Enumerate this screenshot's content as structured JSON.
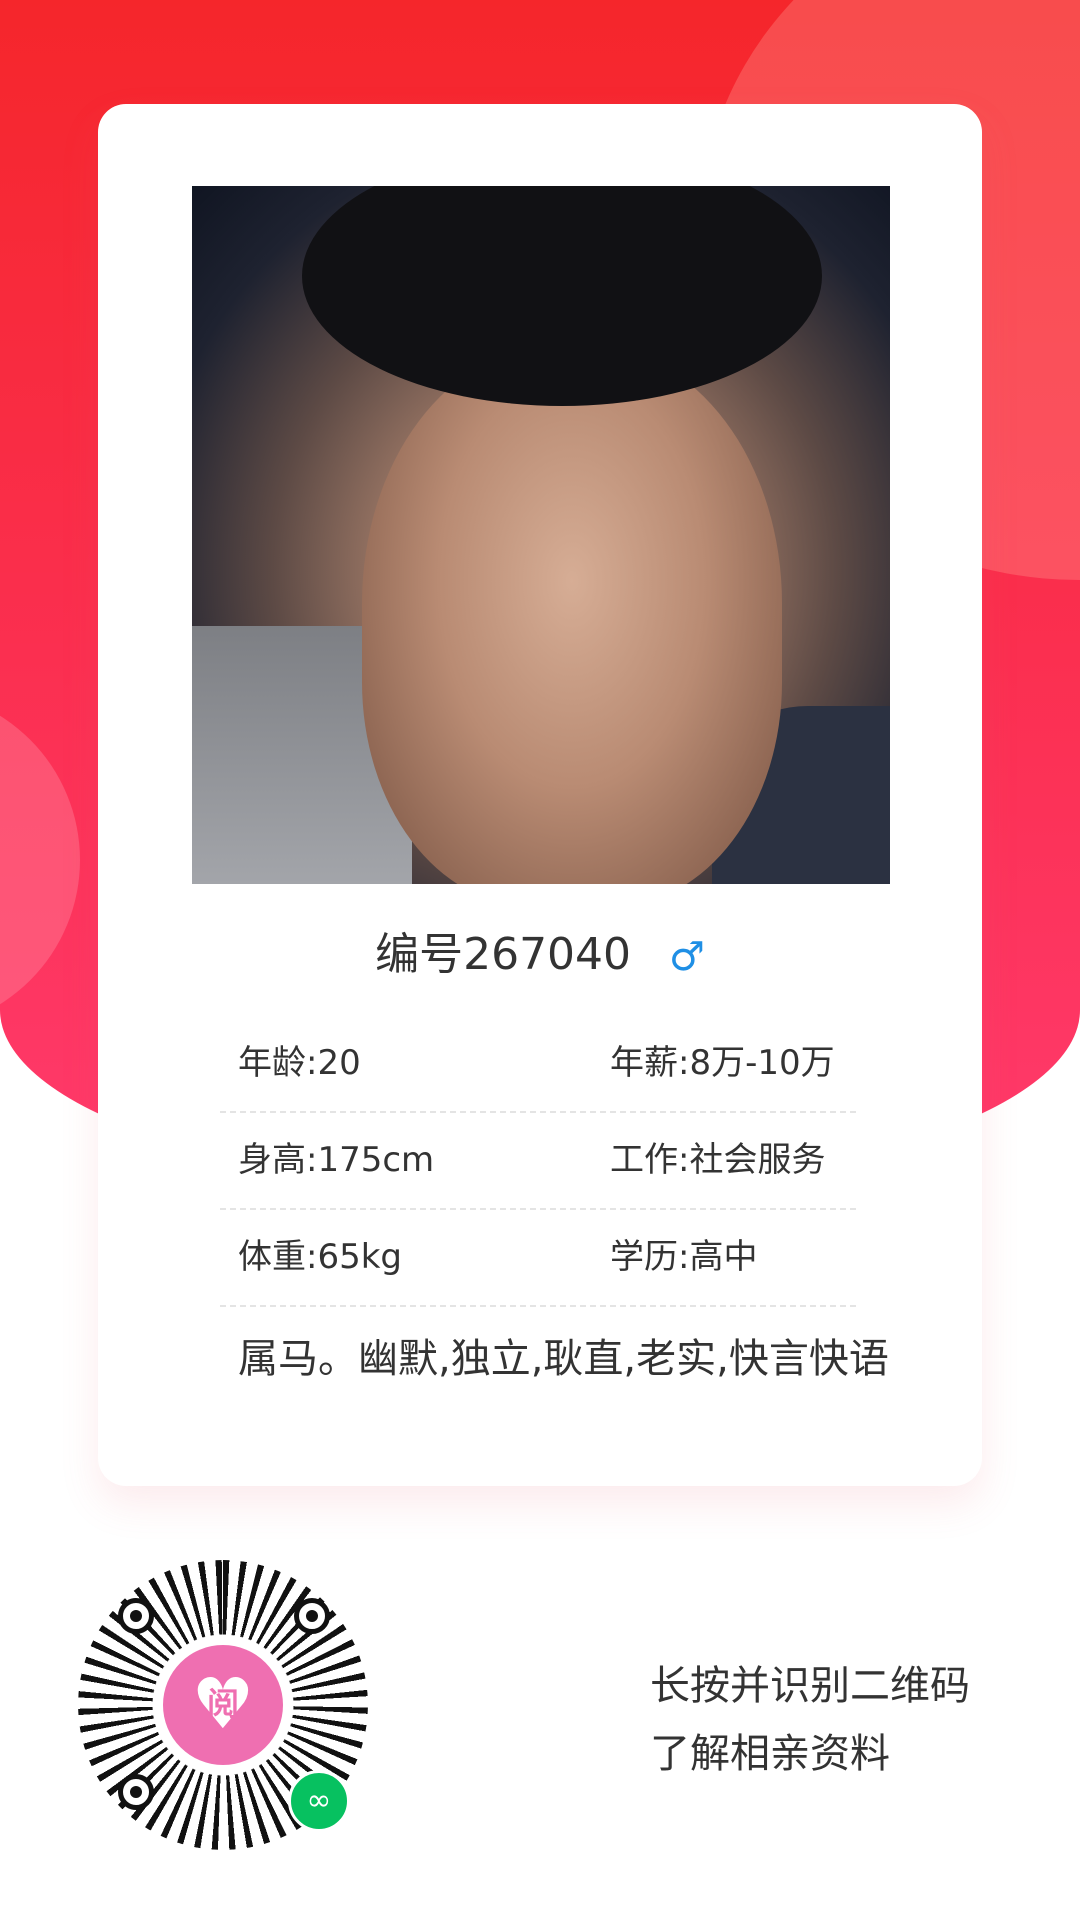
{
  "profile": {
    "id_label": "编号267040",
    "gender_icon": "♂",
    "photo_alt": "profile-photo",
    "details": [
      {
        "left": "年龄:20",
        "right": "年薪:8万-10万"
      },
      {
        "left": "身高:175cm",
        "right": "工作:社会服务"
      },
      {
        "left": "体重:65kg",
        "right": "学历:高中"
      }
    ],
    "description": "属马。幽默,独立,耿直,老实,快言快语"
  },
  "footer": {
    "prompt_line1": "长按并识别二维码",
    "prompt_line2": "了解相亲资料",
    "qr_heart_char": "阅"
  },
  "colors": {
    "hero_red": "#f5262b",
    "hero_pink": "#ff3a6c",
    "gender_blue": "#1f8fe5",
    "miniprogram_green": "#07c160",
    "qr_pink": "#ef6fb1"
  }
}
